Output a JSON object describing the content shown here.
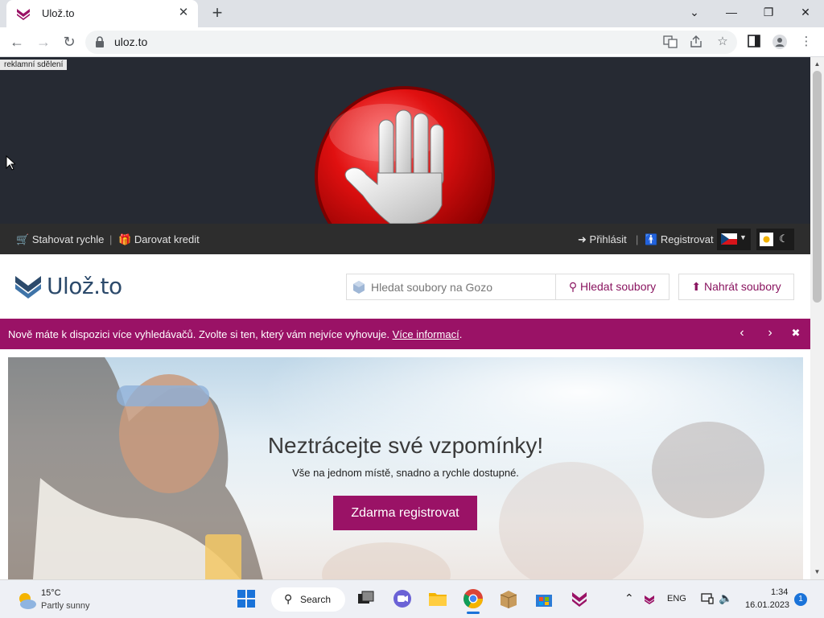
{
  "browser": {
    "tab_title": "Ulož.to",
    "tab_close": "✕",
    "new_tab": "+",
    "url": "uloz.to",
    "controls": {
      "tab_search": "⌄",
      "minimize": "—",
      "restore": "❐",
      "close": "✕"
    }
  },
  "ad": {
    "label": "reklamní sdělení"
  },
  "topbar": {
    "fast_download": "Stahovat rychle",
    "gift_credit": "Darovat kredit",
    "separator": "|",
    "login": "Přihlásit",
    "register": "Registrovat"
  },
  "header": {
    "logo_text": "Ulož.to",
    "search_placeholder": "Hledat soubory na Gozo",
    "search_button": "Hledat soubory",
    "upload_button": "Nahrát soubory"
  },
  "notice": {
    "message": "Nově máte k dispozici více vyhledávačů. Zvolte si ten, který vám nejvíce vyhovuje.",
    "link": "Více informací",
    "period": "."
  },
  "hero": {
    "headline": "Neztrácejte své vzpomínky!",
    "subline": "Vše na jednom místě, snadno a rychle dostupné.",
    "cta": "Zdarma registrovat"
  },
  "taskbar": {
    "weather_temp": "15°C",
    "weather_condition": "Partly sunny",
    "search_label": "Search",
    "language": "ENG",
    "time": "1:34",
    "date": "16.01.2023",
    "notification_count": "1"
  },
  "colors": {
    "brand_magenta": "#9a1266",
    "ad_background": "#262a33",
    "topbar_background": "#2d2d2d",
    "logo_blue": "#2c4a6b"
  }
}
